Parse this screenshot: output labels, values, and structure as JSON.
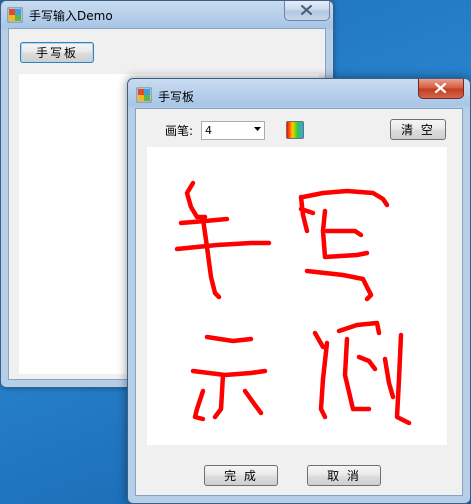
{
  "main_window": {
    "title": "手写输入Demo",
    "handwriting_button": "手写板"
  },
  "pad_window": {
    "title": "手写板",
    "pen_label": "画笔:",
    "pen_size": "4",
    "clear_button": "清 空",
    "ok_button": "完 成",
    "cancel_button": "取 消",
    "ink_color": "#ff0000"
  },
  "icons": {
    "app": "app-window-icon",
    "close": "close-x-icon",
    "dropdown": "chevron-down-icon",
    "color_picker": "color-gradient-icon"
  }
}
